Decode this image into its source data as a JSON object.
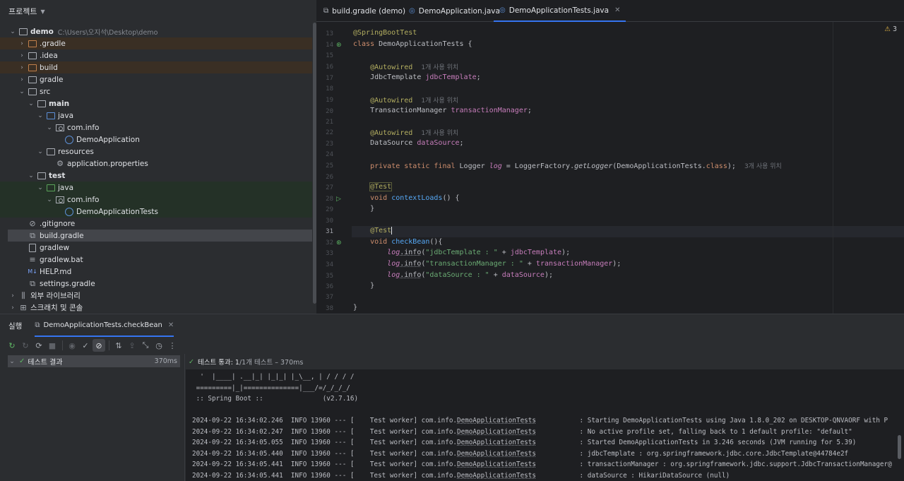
{
  "project": {
    "title": "프로젝트",
    "tree": [
      {
        "label": "demo",
        "path": "C:\\Users\\오지석\\Desktop\\demo",
        "icon": "module-folder-icon",
        "indent": 0,
        "arrow": "down",
        "bold": true,
        "hl": ""
      },
      {
        "label": ".gradle",
        "icon": "folder-icon",
        "indent": 1,
        "arrow": "right",
        "hl": "orange",
        "color": "orange"
      },
      {
        "label": ".idea",
        "icon": "folder-icon",
        "indent": 1,
        "arrow": "right",
        "hl": ""
      },
      {
        "label": "build",
        "icon": "folder-icon",
        "indent": 1,
        "arrow": "right",
        "hl": "orange",
        "color": "orange"
      },
      {
        "label": "gradle",
        "icon": "folder-icon",
        "indent": 1,
        "arrow": "right",
        "hl": ""
      },
      {
        "label": "src",
        "icon": "folder-icon",
        "indent": 1,
        "arrow": "down",
        "hl": ""
      },
      {
        "label": "main",
        "icon": "module-folder-icon",
        "indent": 2,
        "arrow": "down",
        "bold": true,
        "hl": ""
      },
      {
        "label": "java",
        "icon": "source-folder-icon",
        "indent": 3,
        "arrow": "down",
        "hl": "",
        "color": "blue"
      },
      {
        "label": "com.info",
        "icon": "package-icon",
        "indent": 4,
        "arrow": "down",
        "hl": ""
      },
      {
        "label": "DemoApplication",
        "icon": "class-icon",
        "indent": 5,
        "arrow": "",
        "hl": ""
      },
      {
        "label": "resources",
        "icon": "resources-folder-icon",
        "indent": 3,
        "arrow": "down",
        "hl": ""
      },
      {
        "label": "application.properties",
        "icon": "properties-icon",
        "indent": 4,
        "arrow": "",
        "hl": ""
      },
      {
        "label": "test",
        "icon": "module-folder-icon",
        "indent": 2,
        "arrow": "down",
        "bold": true,
        "hl": ""
      },
      {
        "label": "java",
        "icon": "test-folder-icon",
        "indent": 3,
        "arrow": "down",
        "hl": "green",
        "color": "green"
      },
      {
        "label": "com.info",
        "icon": "package-icon",
        "indent": 4,
        "arrow": "down",
        "hl": "green"
      },
      {
        "label": "DemoApplicationTests",
        "icon": "class-icon",
        "indent": 5,
        "arrow": "",
        "hl": "green"
      },
      {
        "label": ".gitignore",
        "icon": "ignore-file-icon",
        "indent": 1,
        "arrow": "",
        "hl": ""
      },
      {
        "label": "build.gradle",
        "icon": "gradle-icon",
        "indent": 1,
        "arrow": "",
        "hl": "",
        "selected": true
      },
      {
        "label": "gradlew",
        "icon": "file-icon",
        "indent": 1,
        "arrow": "",
        "hl": ""
      },
      {
        "label": "gradlew.bat",
        "icon": "text-file-icon",
        "indent": 1,
        "arrow": "",
        "hl": ""
      },
      {
        "label": "HELP.md",
        "icon": "markdown-icon",
        "indent": 1,
        "arrow": "",
        "hl": ""
      },
      {
        "label": "settings.gradle",
        "icon": "gradle-icon",
        "indent": 1,
        "arrow": "",
        "hl": ""
      },
      {
        "label": "외부 라이브러리",
        "icon": "library-icon",
        "indent": 0,
        "arrow": "right",
        "hl": ""
      },
      {
        "label": "스크래치 및 콘솔",
        "icon": "scratch-icon",
        "indent": 0,
        "arrow": "right",
        "hl": ""
      }
    ]
  },
  "editor": {
    "tabs": [
      {
        "label": "build.gradle (demo)",
        "icon": "gradle-icon",
        "active": false
      },
      {
        "label": "DemoApplication.java",
        "icon": "class-icon",
        "active": false
      },
      {
        "label": "DemoApplicationTests.java",
        "icon": "class-icon",
        "active": true
      }
    ],
    "warning_count": "3",
    "current_line": 31,
    "line_numbers": [
      "13",
      "14",
      "15",
      "16",
      "17",
      "18",
      "19",
      "20",
      "21",
      "22",
      "23",
      "24",
      "25",
      "26",
      "27",
      "28",
      "29",
      "30",
      "31",
      "32",
      "33",
      "34",
      "35",
      "36",
      "37",
      "38"
    ],
    "gutter_icons": {
      "14": "run-icon",
      "28": "run-icon",
      "32": "run-icon"
    },
    "usage_hint": "1개 사용 위치",
    "usage_hint_3": "3개 사용 위치",
    "code": {
      "l13": "@SpringBootTest",
      "l14_kw": "class",
      "l14_rest": " DemoApplicationTests {",
      "autowired": "@Autowired",
      "l17_type": "JdbcTemplate ",
      "l17_field": "jdbcTemplate",
      "l20_type": "TransactionManager ",
      "l20_field": "transactionManager",
      "l23_type": "DataSource ",
      "l23_field": "dataSource",
      "l25_kw": "private static final ",
      "l25_type": "Logger ",
      "l25_field": "log",
      "l25_mid": " = LoggerFactory.",
      "l25_method": "getLogger",
      "l25_arg": "(DemoApplicationTests.",
      "l25_class": "class",
      "l25_end": ");",
      "test_ann": "@Test",
      "void": "void ",
      "l28_fn": "contextLoads",
      "l28_end": "() {",
      "close_brace": "}",
      "l32_fn": "checkBean",
      "l32_end": "(){",
      "log": "log",
      "info": ".info",
      "l33_str": "\"jdbcTemplate : \"",
      "l33_field": "jdbcTemplate",
      "l34_str": "\"transactionManager : \"",
      "l34_field": "transactionManager",
      "l35_str": "\"dataSource : \"",
      "l35_field": "dataSource",
      "plus": " + ",
      "open_paren": "(",
      "end_stmt": ");"
    }
  },
  "run": {
    "title": "실행",
    "tab_label": "DemoApplicationTests.checkBean",
    "result_label": "테스트 결과",
    "result_time": "370ms",
    "status_pass": "테스트 통과: 1",
    "status_detail": " /1개 테스트 – 370ms",
    "banner": [
      "  '  |____| .__|_| |_|_| |_\\__, | / / / /",
      " =========|_|==============|___/=/_/_/_/",
      " :: Spring Boot ::               (v2.7.16)"
    ],
    "log_lines": [
      {
        "prefix": "2024-09-22 16:34:02.246  INFO 13960 --- [    Test worker] com.info.",
        "cls": "DemoApplicationTests",
        "msg": "           : Starting DemoApplicationTests using Java 1.8.0_202 on DESKTOP-QNVAORF with P"
      },
      {
        "prefix": "2024-09-22 16:34:02.247  INFO 13960 --- [    Test worker] com.info.",
        "cls": "DemoApplicationTests",
        "msg": "           : No active profile set, falling back to 1 default profile: \"default\""
      },
      {
        "prefix": "2024-09-22 16:34:05.055  INFO 13960 --- [    Test worker] com.info.",
        "cls": "DemoApplicationTests",
        "msg": "           : Started DemoApplicationTests in 3.246 seconds (JVM running for 5.39)"
      },
      {
        "prefix": "2024-09-22 16:34:05.440  INFO 13960 --- [    Test worker] com.info.",
        "cls": "DemoApplicationTests",
        "msg": "           : jdbcTemplate : org.springframework.jdbc.core.JdbcTemplate@44784e2f"
      },
      {
        "prefix": "2024-09-22 16:34:05.441  INFO 13960 --- [    Test worker] com.info.",
        "cls": "DemoApplicationTests",
        "msg": "           : transactionManager : org.springframework.jdbc.support.JdbcTransactionManager@"
      },
      {
        "prefix": "2024-09-22 16:34:05.441  INFO 13960 --- [    Test worker] com.info.",
        "cls": "DemoApplicationTests",
        "msg": "           : dataSource : HikariDataSource (null)"
      }
    ]
  },
  "colors": {
    "accent": "#3574f0",
    "pass": "#5fb865",
    "annotation": "#b3ae60",
    "keyword": "#cf8e6d",
    "field": "#c77dbb",
    "function": "#56a8f5",
    "string": "#6aab73"
  }
}
